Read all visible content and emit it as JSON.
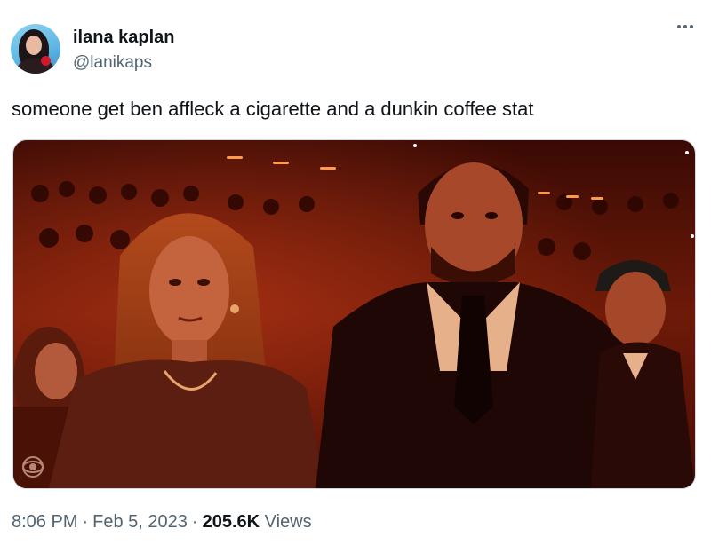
{
  "author": {
    "display_name": "ilana kaplan",
    "handle": "@lanikaps"
  },
  "tweet": {
    "text": "someone get ben affleck a cigarette and a dunkin coffee stat"
  },
  "meta": {
    "time": "8:06 PM",
    "separator": "·",
    "date": "Feb 5, 2023",
    "views_count": "205.6K",
    "views_label": "Views"
  },
  "icons": {
    "more": "more-horizontal-icon",
    "broadcaster": "cbs-eye-logo"
  },
  "colors": {
    "text_primary": "#0f1419",
    "text_secondary": "#536471",
    "photo_tint": "#c23a18"
  }
}
